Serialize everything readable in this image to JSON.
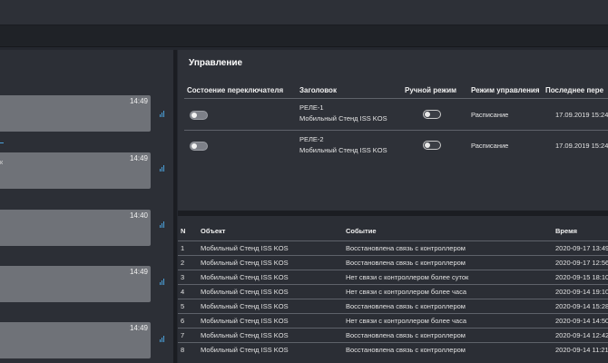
{
  "colors": {
    "background": "#24272e",
    "panel": "#2e3138",
    "message_bubble": "#6f7278",
    "accent": "#4a9fd8",
    "divider": "#5e626a"
  },
  "chat": {
    "messages": [
      {
        "time": "14:49"
      },
      {
        "time": "14:49"
      },
      {
        "time": "14:40"
      },
      {
        "time": "14:49"
      },
      {
        "time": "14:49"
      }
    ],
    "side_text": "к"
  },
  "control": {
    "title": "Управление",
    "columns": [
      "Состоение переключателя",
      "Заголовок",
      "Ручной режим",
      "Режим управления",
      "Последнее пере"
    ],
    "rows": [
      {
        "switch_state": "off",
        "title_line1": "РЕЛЕ-1",
        "title_line2": "Мобильный Стенд ISS KOS",
        "manual_mode": "off",
        "control_mode": "Расписание",
        "last_change": "17.09.2019 15:24"
      },
      {
        "switch_state": "off",
        "title_line1": "РЕЛЕ-2",
        "title_line2": "Мобильный Стенд ISS KOS",
        "manual_mode": "off",
        "control_mode": "Расписание",
        "last_change": "17.09.2019 15:24"
      }
    ]
  },
  "events": {
    "columns": [
      "N",
      "Объект",
      "Событие",
      "Время"
    ],
    "rows": [
      {
        "n": "1",
        "object": "Мобильный Стенд ISS KOS",
        "event": "Восстановлена связь с контроллером",
        "time": "2020-09-17 13:49:"
      },
      {
        "n": "2",
        "object": "Мобильный Стенд ISS KOS",
        "event": "Восстановлена связь с контроллером",
        "time": "2020-09-17 12:56:"
      },
      {
        "n": "3",
        "object": "Мобильный Стенд ISS KOS",
        "event": "Нет связи с контроллером более суток",
        "time": "2020-09-15 18:10:"
      },
      {
        "n": "4",
        "object": "Мобильный Стенд ISS KOS",
        "event": "Нет связи с контроллером более часа",
        "time": "2020-09-14 19:10:"
      },
      {
        "n": "5",
        "object": "Мобильный Стенд ISS KOS",
        "event": "Восстановлена связь с контроллером",
        "time": "2020-09-14 15:28:"
      },
      {
        "n": "6",
        "object": "Мобильный Стенд ISS KOS",
        "event": "Нет связи с контроллером более часа",
        "time": "2020-09-14 14:50:"
      },
      {
        "n": "7",
        "object": "Мобильный Стенд ISS KOS",
        "event": "Восстановлена связь с контроллером",
        "time": "2020-09-14 12:42:"
      },
      {
        "n": "8",
        "object": "Мобильный Стенд ISS KOS",
        "event": "Восстановлена связь с контроллером",
        "time": "2020-09-14 11:21:"
      }
    ]
  }
}
